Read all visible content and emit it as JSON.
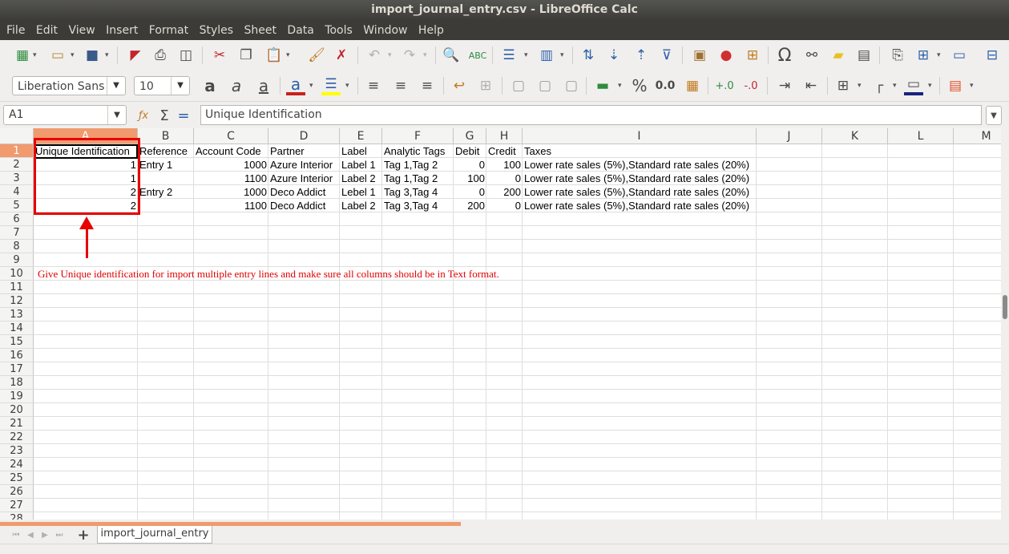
{
  "window": {
    "title": "import_journal_entry.csv - LibreOffice Calc"
  },
  "menu": [
    "File",
    "Edit",
    "View",
    "Insert",
    "Format",
    "Styles",
    "Sheet",
    "Data",
    "Tools",
    "Window",
    "Help"
  ],
  "font": {
    "name": "Liberation Sans",
    "size": "10"
  },
  "formula_bar": {
    "cell_ref": "A1",
    "content": "Unique Identification",
    "fx_symbol": "ƒx",
    "sum_symbol": "Σ",
    "equals_symbol": "="
  },
  "columns": [
    "A",
    "B",
    "C",
    "D",
    "E",
    "F",
    "G",
    "H",
    "I",
    "J",
    "K",
    "L",
    "M"
  ],
  "rows": [
    "1",
    "2",
    "3",
    "4",
    "5",
    "6",
    "7",
    "8",
    "9",
    "10",
    "11",
    "12",
    "13",
    "14",
    "15",
    "16",
    "17",
    "18",
    "19",
    "20",
    "21",
    "22",
    "23",
    "24",
    "25",
    "26",
    "27",
    "28"
  ],
  "sheet": {
    "header": [
      "Unique Identification",
      "Reference",
      "Account Code",
      "Partner",
      "Label",
      "Analytic Tags",
      "Debit",
      "Credit",
      "Taxes"
    ],
    "data": [
      [
        "1",
        "Entry 1",
        "1000",
        "Azure Interior",
        "Label 1",
        "Tag 1,Tag 2",
        "0",
        "100",
        "Lower rate sales (5%),Standard rate sales (20%)"
      ],
      [
        "1",
        "",
        "1100",
        "Azure Interior",
        "Label 2",
        "Tag 1,Tag 2",
        "100",
        "0",
        "Lower rate sales (5%),Standard rate sales (20%)"
      ],
      [
        "2",
        "Entry 2",
        "1000",
        "Deco Addict",
        "Lebel 1",
        "Tag 3,Tag 4",
        "0",
        "200",
        "Lower rate sales (5%),Standard rate sales (20%)"
      ],
      [
        "2",
        "",
        "1100",
        "Deco Addict",
        "Label 2",
        "Tag 3,Tag 4",
        "200",
        "0",
        "Lower rate sales (5%),Standard rate sales (20%)"
      ]
    ]
  },
  "annotation": "Give Unique identification for import multiple entry lines and make sure all columns should be in Text format.",
  "tabs": {
    "active": "import_journal_entry",
    "add": "+"
  },
  "colors": {
    "accent": "#f09a6e",
    "annotation": "#e80000"
  }
}
